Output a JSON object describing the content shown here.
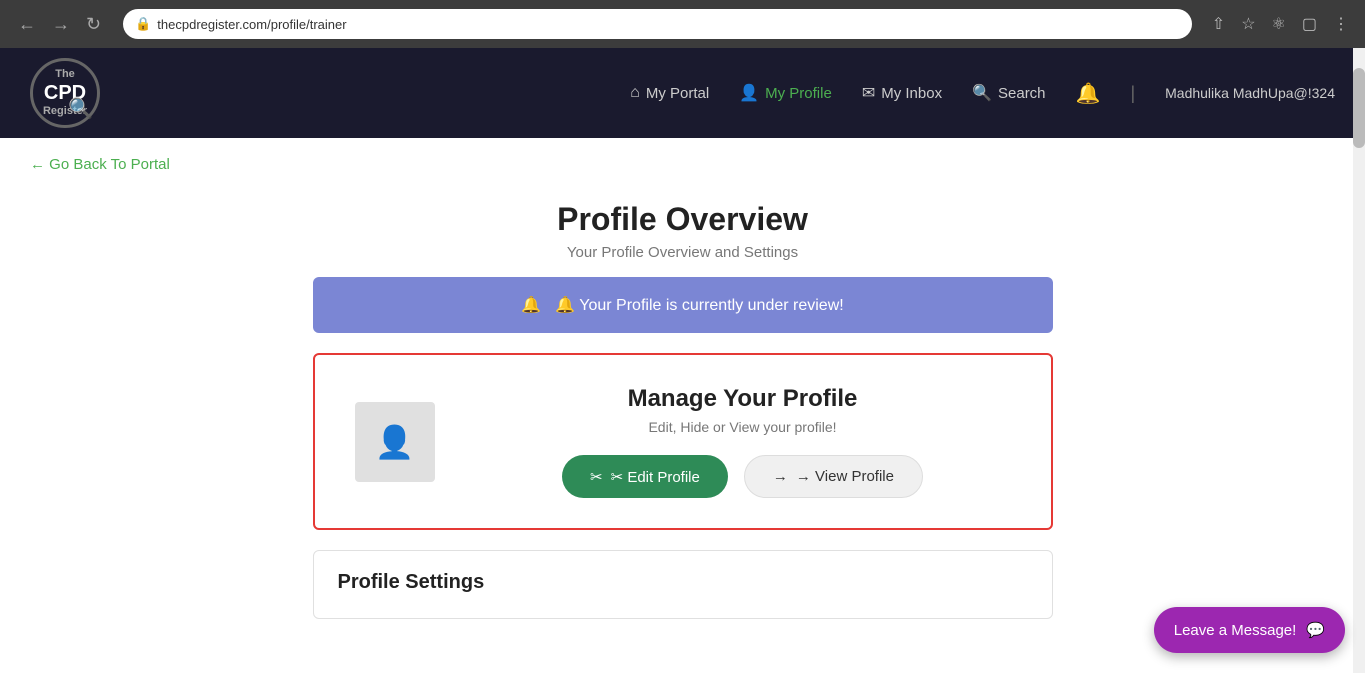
{
  "browser": {
    "url": "thecpdregister.com/profile/trainer",
    "back_btn": "←",
    "forward_btn": "→",
    "refresh_btn": "↻"
  },
  "navbar": {
    "logo_top": "The",
    "logo_cpd": "CPD",
    "logo_bottom": "Register",
    "nav_items": [
      {
        "id": "my-portal",
        "label": "My Portal",
        "icon": "⌂",
        "active": false
      },
      {
        "id": "my-profile",
        "label": "My Profile",
        "icon": "👤",
        "active": true
      },
      {
        "id": "my-inbox",
        "label": "My Inbox",
        "icon": "✉",
        "active": false
      },
      {
        "id": "search",
        "label": "Search",
        "icon": "🔍",
        "active": false
      }
    ],
    "user_name": "Madhulika MadhUpa@!324"
  },
  "page": {
    "go_back": "← Go Back To Portal",
    "title": "Profile Overview",
    "subtitle": "Your Profile Overview and Settings",
    "alert": "🔔 Your Profile is currently under review!",
    "manage_card": {
      "title": "Manage Your Profile",
      "subtitle": "Edit, Hide or View your profile!",
      "edit_button": "✂ Edit Profile",
      "view_button": "→ View Profile"
    },
    "settings_title": "Profile Settings"
  },
  "leave_message": {
    "label": "Leave a Message!",
    "icon": "💬"
  }
}
